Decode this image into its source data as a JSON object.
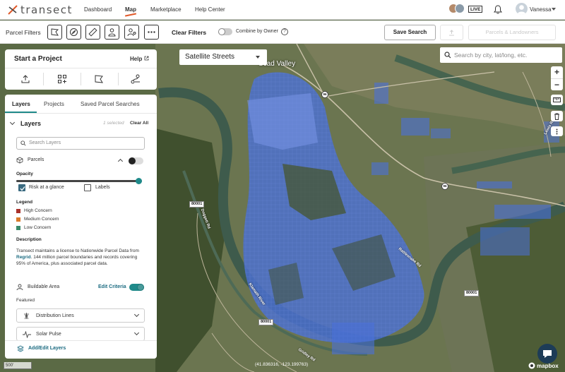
{
  "nav": {
    "logo": "transect",
    "links": [
      "Dashboard",
      "Map",
      "Marketplace",
      "Help Center"
    ],
    "live": "LIVE",
    "user": "Vanessa"
  },
  "filters": {
    "label": "Parcel Filters",
    "clear": "Clear Filters",
    "combine": "Combine by Owner",
    "help": "?",
    "save": "Save Search",
    "parcels_landowners": "Parcels & Landowners"
  },
  "map": {
    "style": "Satellite Streets",
    "search_placeholder": "Search by city, lat/long, etc.",
    "zoom_in": "+",
    "zoom_out": "−",
    "town": "Scad Valley",
    "scale": "500'",
    "coords": "(41.836316, -123.199763)",
    "attribution": "mapbox",
    "road_labels": [
      "80001",
      "80001",
      "80001"
    ],
    "highway_shields": [
      "96",
      "96"
    ],
    "place_labels": [
      "Doggett Rd",
      "Rattlesnake Rd",
      "Klamath River",
      "Gridley Rd",
      "Lewis Rd"
    ]
  },
  "project": {
    "title": "Start a Project",
    "help": "Help"
  },
  "layers": {
    "tabs": [
      "Layers",
      "Projects",
      "Saved Parcel Searches"
    ],
    "heading": "Layers",
    "selected": "1 selected",
    "clear_all": "Clear All",
    "search_placeholder": "Search Layers",
    "parcels": "Parcels",
    "opacity": "Opacity",
    "opacity_value": 0.97,
    "risk_at_glance": "Risk at a glance",
    "labels": "Labels",
    "legend_title": "Legend",
    "legend": [
      {
        "label": "High Concern",
        "color": "#a8312b"
      },
      {
        "label": "Medium Concern",
        "color": "#d97a2a"
      },
      {
        "label": "Low Concern",
        "color": "#3a8a6a"
      }
    ],
    "description_title": "Description",
    "description_pre": "Transect maintains a license to Nationwide Parcel Data from",
    "description_link": "Regrid",
    "description_post": ". 144 million parcel boundaries and records covering 95% of America, plus associated parcel data.",
    "buildable": "Buildable Area",
    "edit_criteria": "Edit Criteria",
    "featured": "Featured",
    "distribution": "Distribution Lines",
    "solar": "Solar Pulse",
    "add_edit": "Add/Edit Layers"
  }
}
